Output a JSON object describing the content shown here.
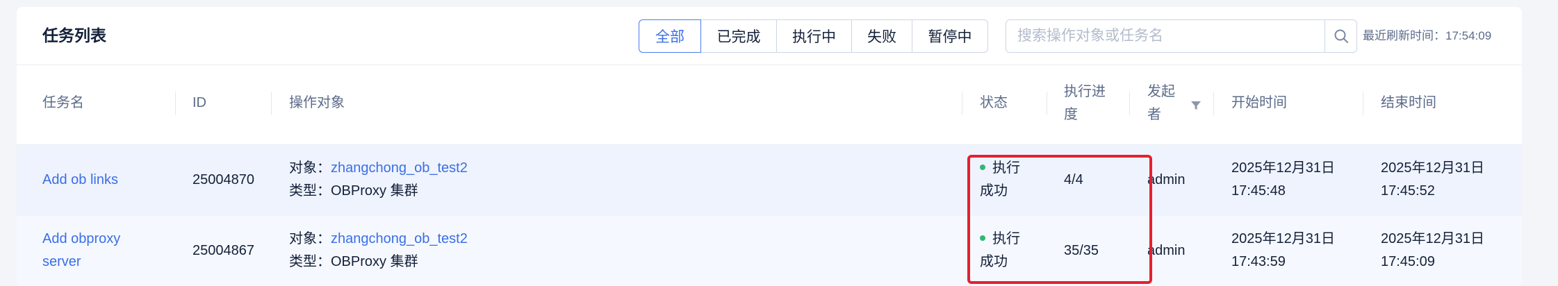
{
  "page": {
    "title": "任务列表",
    "refresh_label": "最近刷新时间：17:54:09"
  },
  "filters": [
    {
      "label": "全部",
      "active": true
    },
    {
      "label": "已完成",
      "active": false
    },
    {
      "label": "执行中",
      "active": false
    },
    {
      "label": "失败",
      "active": false
    },
    {
      "label": "暂停中",
      "active": false
    }
  ],
  "search": {
    "placeholder": "搜索操作对象或任务名",
    "value": ""
  },
  "table": {
    "columns": {
      "name": "任务名",
      "id": "ID",
      "target": "操作对象",
      "status": "状态",
      "progress_line1": "执行进",
      "progress_line2": "度",
      "initiator_line1": "发起",
      "initiator_line2": "者",
      "start_time": "开始时间",
      "end_time": "结束时间"
    },
    "rows": [
      {
        "name_line1": "Add ob links",
        "name_line2": "",
        "id": "25004870",
        "target_prefix": "对象：",
        "target_name": "zhangchong_ob_test2",
        "type_text": "类型：OBProxy 集群",
        "status_line1": "执行",
        "status_line2": "成功",
        "progress": "4/4",
        "initiator": "admin",
        "start_date": "2025年12月31日",
        "start_time": "17:45:48",
        "end_date": "2025年12月31日",
        "end_time": "17:45:52"
      },
      {
        "name_line1": "Add obproxy",
        "name_line2": "server",
        "id": "25004867",
        "target_prefix": "对象：",
        "target_name": "zhangchong_ob_test2",
        "type_text": "类型：OBProxy 集群",
        "status_line1": "执行",
        "status_line2": "成功",
        "progress": "35/35",
        "initiator": "admin",
        "start_date": "2025年12月31日",
        "start_time": "17:43:59",
        "end_date": "2025年12月31日",
        "end_time": "17:45:09"
      }
    ]
  },
  "colors": {
    "accent": "#3a6ee8",
    "success": "#2fb873",
    "highlight": "#e5202f"
  },
  "icons": {
    "search": "search-icon",
    "filter": "filter-icon",
    "status": "status-dot-icon"
  }
}
